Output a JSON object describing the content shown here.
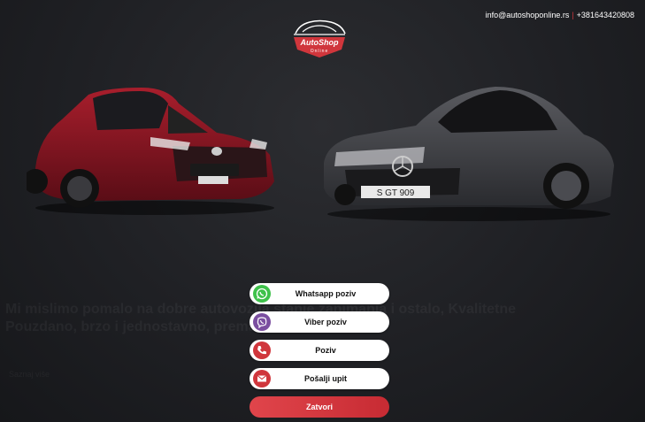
{
  "header": {
    "email": "info@autoshoponline.rs",
    "separator": "|",
    "phone": "+381643420808"
  },
  "logo": {
    "line1": "AutoShop",
    "line2": "Online"
  },
  "background": {
    "tagline": "Mi mislimo pomalo na dobre autovozila stanje zanimanja i ostalo, Kvalitetne",
    "tagline2": "Pouzdano, brzo i jednostavno, prema vašem ukusu",
    "small": "Saznaj više"
  },
  "actions": [
    {
      "label": "Whatsapp poziv",
      "icon": "whatsapp-icon",
      "color": "#3ec14a"
    },
    {
      "label": "Viber poziv",
      "icon": "viber-icon",
      "color": "#7b4fa0"
    },
    {
      "label": "Poziv",
      "icon": "phone-icon",
      "color": "#d0363c"
    },
    {
      "label": "Pošalji upit",
      "icon": "mail-icon",
      "color": "#d0363c"
    }
  ],
  "close": {
    "label": "Zatvori"
  },
  "colors": {
    "accent": "#d0363c",
    "background": "#1f2024"
  }
}
